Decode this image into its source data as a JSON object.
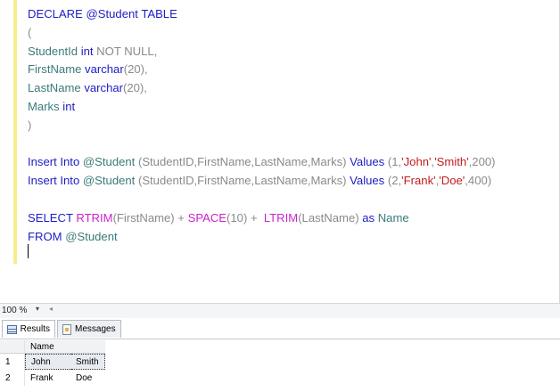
{
  "editor": {
    "lines": [
      [
        {
          "t": "DECLARE @Student TABLE",
          "c": "kw"
        }
      ],
      [
        {
          "t": "(",
          "c": "gy"
        }
      ],
      [
        {
          "t": "StudentId ",
          "c": "id"
        },
        {
          "t": "int ",
          "c": "kw"
        },
        {
          "t": "NOT NULL,",
          "c": "gy"
        }
      ],
      [
        {
          "t": "FirstName ",
          "c": "id"
        },
        {
          "t": "varchar",
          "c": "kw"
        },
        {
          "t": "(20),",
          "c": "gy"
        }
      ],
      [
        {
          "t": "LastName ",
          "c": "id"
        },
        {
          "t": "varchar",
          "c": "kw"
        },
        {
          "t": "(20),",
          "c": "gy"
        }
      ],
      [
        {
          "t": "Marks ",
          "c": "id"
        },
        {
          "t": "int",
          "c": "kw"
        }
      ],
      [
        {
          "t": ")",
          "c": "gy"
        }
      ],
      [
        {
          "t": "",
          "c": "kw"
        }
      ],
      [
        {
          "t": "Insert Into ",
          "c": "kw"
        },
        {
          "t": "@Student ",
          "c": "id"
        },
        {
          "t": "(StudentID,FirstName,LastName,Marks) ",
          "c": "gy"
        },
        {
          "t": "Values ",
          "c": "kw"
        },
        {
          "t": "(1,",
          "c": "gy"
        },
        {
          "t": "'John'",
          "c": "str"
        },
        {
          "t": ",",
          "c": "gy"
        },
        {
          "t": "'Smith'",
          "c": "str"
        },
        {
          "t": ",200)",
          "c": "gy"
        }
      ],
      [
        {
          "t": "Insert Into ",
          "c": "kw"
        },
        {
          "t": "@Student ",
          "c": "id"
        },
        {
          "t": "(StudentID,FirstName,LastName,Marks) ",
          "c": "gy"
        },
        {
          "t": "Values ",
          "c": "kw"
        },
        {
          "t": "(2,",
          "c": "gy"
        },
        {
          "t": "'Frank'",
          "c": "str"
        },
        {
          "t": ",",
          "c": "gy"
        },
        {
          "t": "'Doe'",
          "c": "str"
        },
        {
          "t": ",400)",
          "c": "gy"
        }
      ],
      [
        {
          "t": "",
          "c": "kw"
        }
      ],
      [
        {
          "t": "SELECT ",
          "c": "kw"
        },
        {
          "t": "RTRIM",
          "c": "fn"
        },
        {
          "t": "(FirstName) + ",
          "c": "gy"
        },
        {
          "t": "SPACE",
          "c": "fn"
        },
        {
          "t": "(10) +  ",
          "c": "gy"
        },
        {
          "t": "LTRIM",
          "c": "fn"
        },
        {
          "t": "(LastName) ",
          "c": "gy"
        },
        {
          "t": "as ",
          "c": "kw"
        },
        {
          "t": "Name",
          "c": "id"
        }
      ],
      [
        {
          "t": "FROM ",
          "c": "kw"
        },
        {
          "t": "@Student",
          "c": "id"
        }
      ]
    ]
  },
  "zoom": {
    "value": "100 %",
    "dropdown_glyph": "▾",
    "scroll_left_glyph": "◂"
  },
  "tabs": {
    "results_label": "Results",
    "messages_label": "Messages"
  },
  "grid": {
    "column_header": "Name",
    "rows": [
      {
        "num": "1",
        "first": "John",
        "last": "Smith"
      },
      {
        "num": "2",
        "first": "Frank",
        "last": "Doe"
      }
    ]
  }
}
